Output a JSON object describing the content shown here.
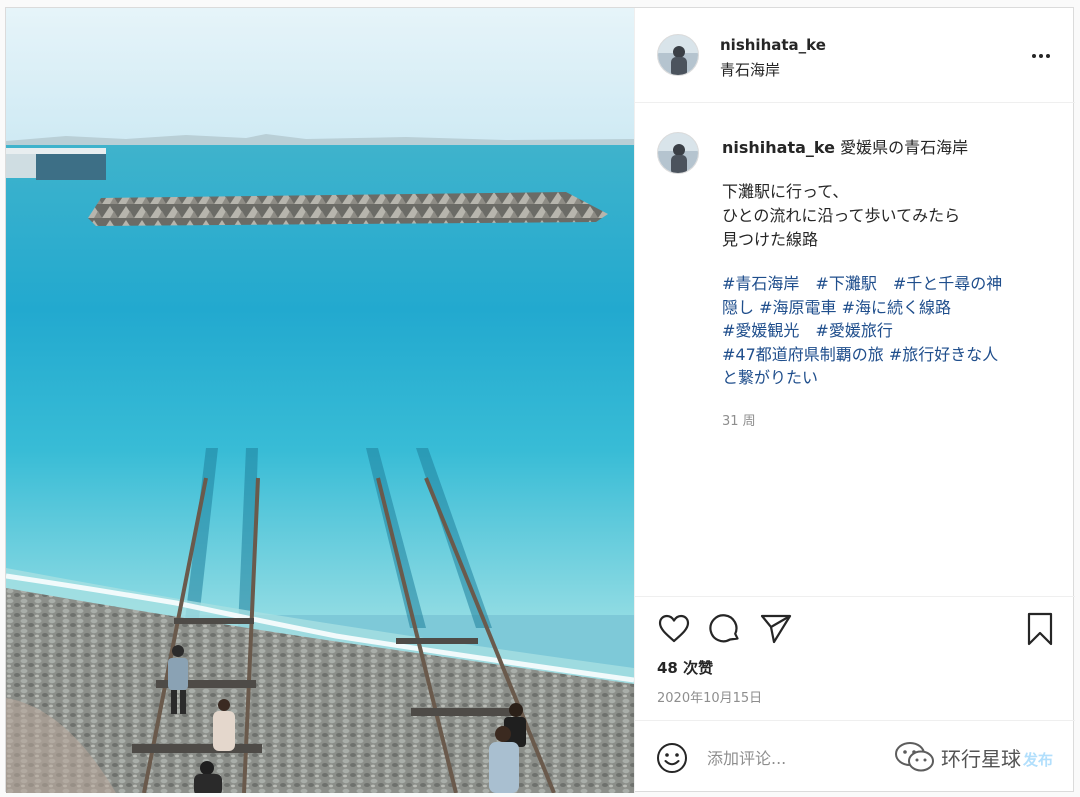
{
  "post": {
    "username": "nishihata_ke",
    "location": "青石海岸"
  },
  "caption": {
    "username": "nishihata_ke",
    "headline": "愛媛県の青石海岸",
    "body_lines": [
      "下灘駅に行って、",
      "ひとの流れに沿って歩いてみたら",
      "見つけた線路"
    ],
    "hashtag_lines": [
      "#青石海岸　#下灘駅　#千と千尋の神",
      "隠し #海原電車 #海に続く線路",
      "#愛媛観光　#愛媛旅行",
      "#47都道府県制覇の旅 #旅行好きな人",
      "と繋がりたい"
    ],
    "age": "31 周"
  },
  "actions": {
    "icons": [
      "heart-icon",
      "comment-icon",
      "share-icon",
      "bookmark-icon"
    ],
    "likes": "48 次赞",
    "date": "2020年10月15日"
  },
  "comment": {
    "placeholder": "添加评论...",
    "post_label": "发布",
    "emoji_icon": "smiley-icon"
  },
  "watermark": {
    "text": "环行星球",
    "icon": "wechat-icon"
  },
  "colors": {
    "hashtag": "#1f4e8c",
    "post_button": "#b2dffc",
    "secondary_text": "#8e8e8e"
  }
}
